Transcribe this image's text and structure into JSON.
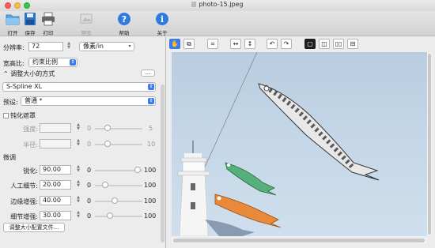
{
  "window": {
    "title": "photo-15.jpeg"
  },
  "toolbar": {
    "open": "打开",
    "save": "保存",
    "print": "打印",
    "preview": "预览",
    "help": "帮助",
    "about": "关于"
  },
  "resolution": {
    "label": "分辨率:",
    "value": "72",
    "unit": "像素/in"
  },
  "aspect": {
    "label": "宽高比:",
    "value": "约束比例"
  },
  "resize_method": {
    "label": "调整大小的方式",
    "more": "...",
    "algorithm": "S-Spline XL"
  },
  "preset": {
    "label": "预设:",
    "value": "普通 *"
  },
  "sharpen_mask": {
    "label": "钝化遮罩",
    "strength": {
      "label": "强度:",
      "min": "0",
      "max": "5"
    },
    "radius": {
      "label": "半径:",
      "min": "0",
      "max": "10"
    }
  },
  "fine_tune": {
    "label": "微调",
    "sharpness": {
      "label": "锐化:",
      "value": "90.00",
      "min": "0",
      "max": "100",
      "level": 0.9
    },
    "artificial_detail": {
      "label": "人工细节:",
      "value": "20.00",
      "min": "0",
      "max": "100",
      "level": 0.2
    },
    "edge_enhance": {
      "label": "边缘增强:",
      "value": "40.00",
      "min": "0",
      "max": "100",
      "level": 0.4
    },
    "detail_enhance": {
      "label": "细节增强:",
      "value": "30.00",
      "min": "0",
      "max": "100",
      "level": 0.3
    }
  },
  "profile_button": "调整大小配置文件...",
  "colors": {
    "accent": "#3a7bf0"
  }
}
